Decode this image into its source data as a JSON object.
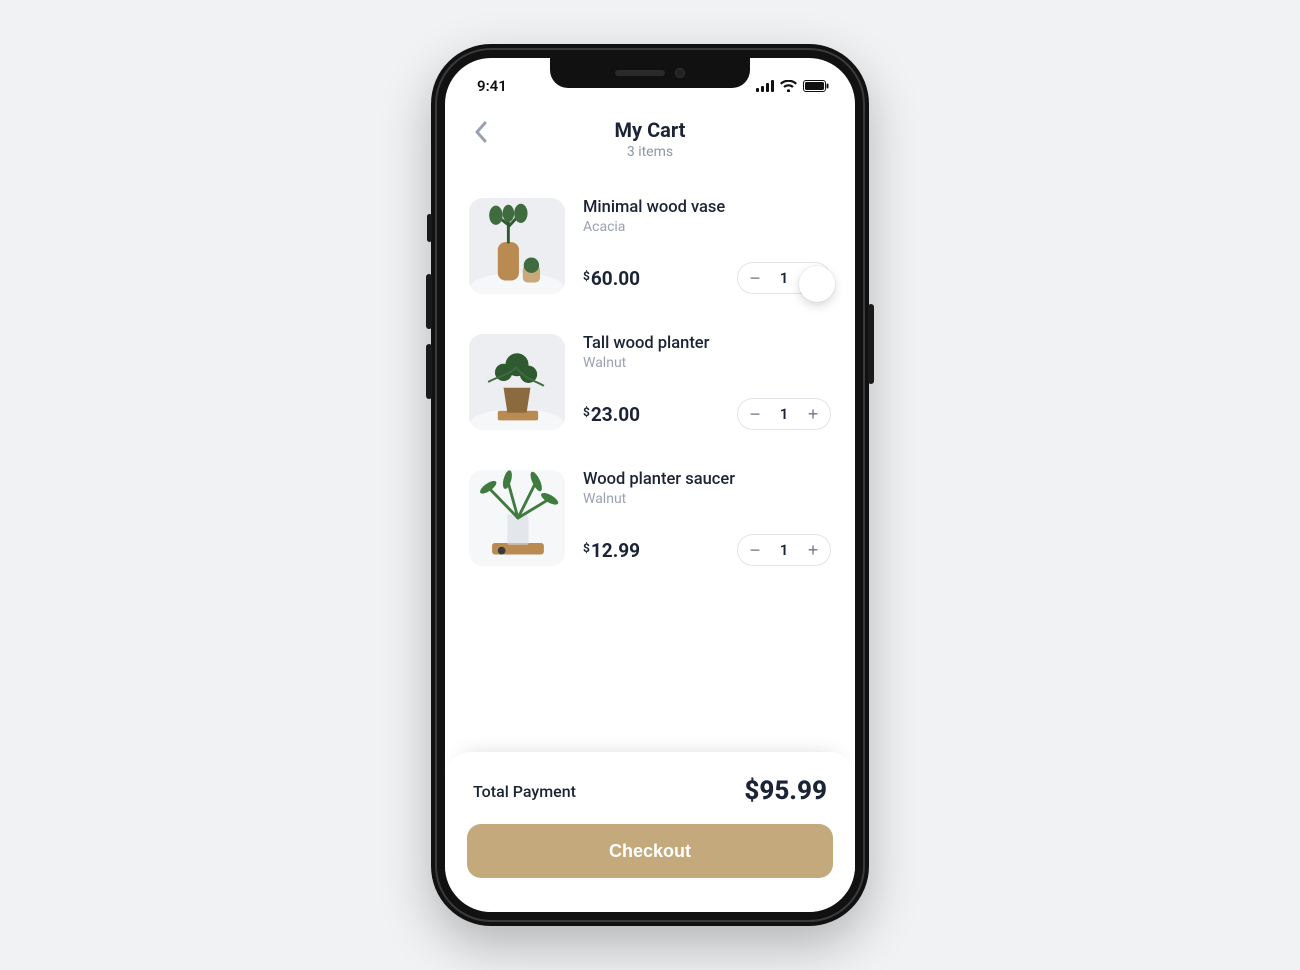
{
  "status": {
    "time": "9:41"
  },
  "header": {
    "title": "My Cart",
    "subtitle": "3 items"
  },
  "cart": {
    "currency": "$",
    "items": [
      {
        "name": "Minimal wood vase",
        "variant": "Acacia",
        "price": "60.00",
        "qty": "1"
      },
      {
        "name": "Tall wood planter",
        "variant": "Walnut",
        "price": "23.00",
        "qty": "1"
      },
      {
        "name": "Wood planter saucer",
        "variant": "Walnut",
        "price": "12.99",
        "qty": "1"
      }
    ]
  },
  "footer": {
    "total_label": "Total Payment",
    "total_amount": "$95.99",
    "checkout_label": "Checkout"
  }
}
